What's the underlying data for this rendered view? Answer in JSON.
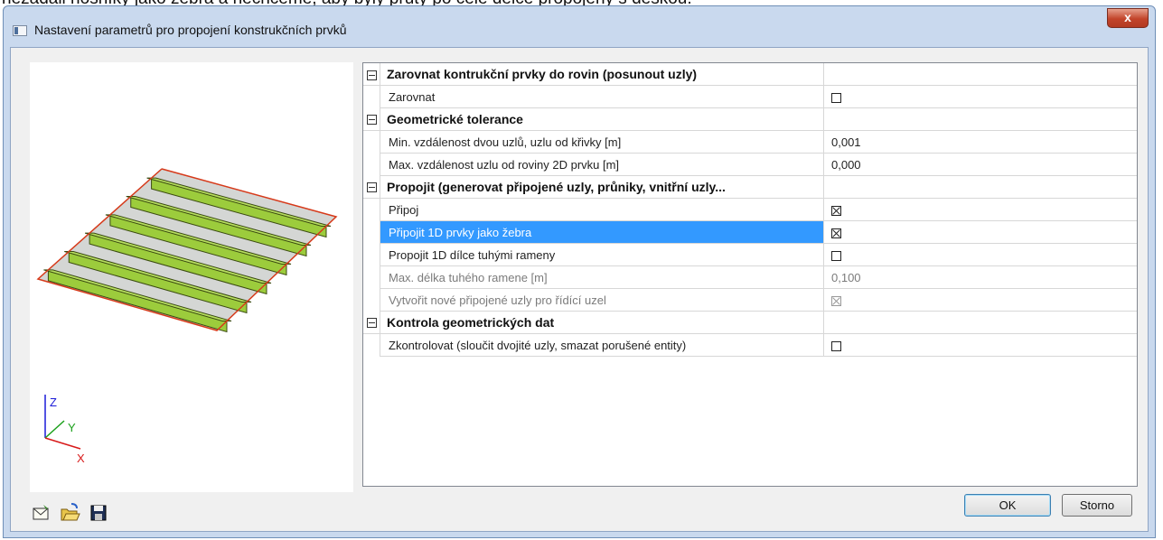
{
  "background_text": "nezadali nosníky jako žebra a nechceme, aby byly pruty po celé délce propojeny s deskou.",
  "window": {
    "title": "Nastavení parametrů pro propojení konstrukčních prvků",
    "close_glyph": "x"
  },
  "preview": {
    "axis_labels": {
      "z": "Z",
      "y": "Y",
      "x": "X"
    },
    "colors": {
      "rib": "#9ccc3c",
      "slab": "#d4d6d4",
      "edge": "#d83a1a"
    }
  },
  "property_grid": {
    "groups": [
      {
        "title": "Zarovnat kontrukční prvky do rovin (posunout uzly)",
        "rows": [
          {
            "label": "Zarovnat",
            "type": "checkbox",
            "checked": false,
            "disabled": false
          }
        ]
      },
      {
        "title": "Geometrické tolerance",
        "rows": [
          {
            "label": "Min. vzdálenost dvou uzlů, uzlu od křivky [m]",
            "type": "text",
            "value": "0,001",
            "disabled": false
          },
          {
            "label": "Max. vzdálenost uzlu od roviny 2D prvku [m]",
            "type": "text",
            "value": "0,000",
            "disabled": false
          }
        ]
      },
      {
        "title": "Propojit (generovat připojené uzly, průniky, vnitřní uzly...",
        "rows": [
          {
            "label": "Připoj",
            "type": "checkbox",
            "checked": true,
            "disabled": false
          },
          {
            "label": "Připojit 1D prvky jako žebra",
            "type": "checkbox",
            "checked": true,
            "disabled": false,
            "selected": true
          },
          {
            "label": "Propojit 1D dílce tuhými rameny",
            "type": "checkbox",
            "checked": false,
            "disabled": false
          },
          {
            "label": "Max. délka tuhého ramene [m]",
            "type": "text",
            "value": "0,100",
            "disabled": true
          },
          {
            "label": "Vytvořit nové připojené uzly pro řídící uzel",
            "type": "checkbox",
            "checked": true,
            "disabled": true
          }
        ]
      },
      {
        "title": "Kontrola geometrických dat",
        "rows": [
          {
            "label": "Zkontrolovat (sloučit dvojité uzly, smazat porušené entity)",
            "type": "checkbox",
            "checked": false,
            "disabled": false
          }
        ]
      }
    ]
  },
  "toolbar": {
    "icons": [
      "envelope-icon",
      "open-folder-icon",
      "save-disk-icon"
    ]
  },
  "buttons": {
    "ok": "OK",
    "cancel": "Storno"
  }
}
